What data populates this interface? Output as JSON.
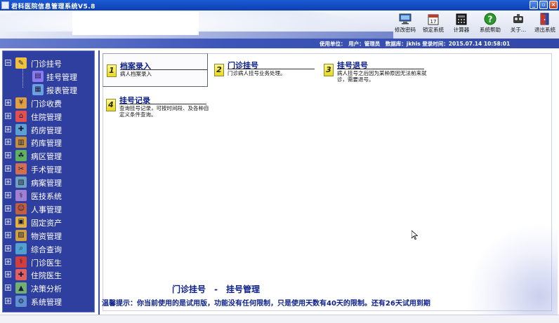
{
  "window": {
    "title": "君科医院信息管理系统V5.8"
  },
  "toolbar": {
    "items": [
      {
        "label": "修改密码",
        "icon": "monitor-icon"
      },
      {
        "label": "锁定系统",
        "icon": "calendar-lock-icon"
      },
      {
        "label": "计算器",
        "icon": "calculator-icon"
      },
      {
        "label": "系统帮助",
        "icon": "help-icon"
      },
      {
        "label": "关于...",
        "icon": "about-icon"
      },
      {
        "label": "退出系统",
        "icon": "exit-door-icon"
      }
    ]
  },
  "infobar": {
    "text": "使用单位：　用户：管理员　数据库：jkhis 登录时间：2015.07.14 10:58:01"
  },
  "sidebar": {
    "items": [
      {
        "label": "门诊挂号",
        "expanded": true,
        "icon": "clipboard-icon"
      },
      {
        "label": "挂号管理",
        "sub": true,
        "selected": true,
        "icon": "register-icon"
      },
      {
        "label": "报表管理",
        "sub": true,
        "icon": "report-icon"
      },
      {
        "label": "门诊收费",
        "icon": "cash-icon"
      },
      {
        "label": "住院管理",
        "icon": "hospital-icon"
      },
      {
        "label": "药房管理",
        "icon": "pharmacy-icon"
      },
      {
        "label": "药库管理",
        "icon": "warehouse-icon"
      },
      {
        "label": "病区管理",
        "icon": "ward-icon"
      },
      {
        "label": "手术管理",
        "icon": "surgery-icon"
      },
      {
        "label": "病案管理",
        "icon": "record-icon"
      },
      {
        "label": "医技系统",
        "icon": "medtech-icon"
      },
      {
        "label": "人事管理",
        "icon": "personnel-icon"
      },
      {
        "label": "固定资产",
        "icon": "assets-icon"
      },
      {
        "label": "物资管理",
        "icon": "materials-icon"
      },
      {
        "label": "综合查询",
        "icon": "query-icon"
      },
      {
        "label": "门诊医生",
        "icon": "doctor-icon"
      },
      {
        "label": "住院医生",
        "icon": "inpatient-doctor-icon"
      },
      {
        "label": "决策分析",
        "icon": "analysis-icon"
      },
      {
        "label": "系统管理",
        "icon": "system-icon"
      }
    ]
  },
  "tiles": [
    {
      "num": "1",
      "title": "档案录入",
      "desc": "病人档案录入",
      "selected": true
    },
    {
      "num": "2",
      "title": "门诊挂号",
      "desc": "门诊病人挂号业务处理。",
      "selected": false
    },
    {
      "num": "3",
      "title": "挂号退号",
      "desc": "病人挂号之后因为某种原因无法前来就诊，需要退号。",
      "selected": false
    },
    {
      "num": "4",
      "title": "挂号记录",
      "desc": "查询挂号记录，可按时间段、及各种自定义条件查询。",
      "selected": false
    }
  ],
  "location": "门诊挂号　-　挂号管理",
  "notice": "温馨提示：你当前使用的是试用版，功能没有任何限制，只是使用天数有40天的限制。还有26天试用到期",
  "colors": {
    "accent": "#0b1f8a",
    "sidebar": "#2f3fa0",
    "titlebar": "#1c5bd4"
  }
}
